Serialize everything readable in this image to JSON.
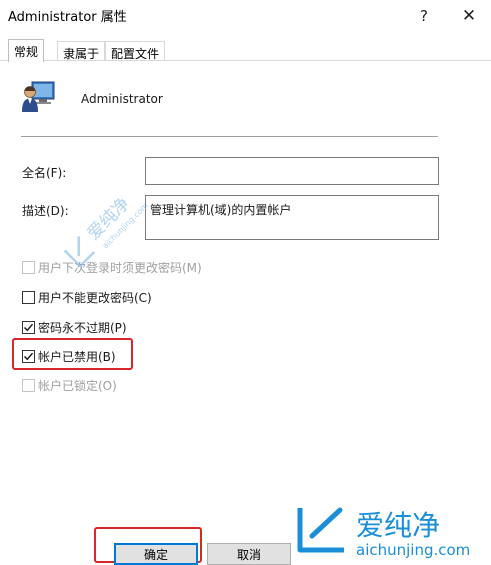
{
  "window": {
    "title": "Administrator 属性",
    "help_glyph": "?",
    "close_glyph": "✕"
  },
  "tabs": [
    {
      "label": "常规",
      "active": true
    },
    {
      "label": "隶属于",
      "active": false
    },
    {
      "label": "配置文件",
      "active": false
    }
  ],
  "user": {
    "name": "Administrator",
    "icon": "user-computer-icon"
  },
  "form": {
    "fullname_label": "全名(F):",
    "fullname_value": "",
    "description_label": "描述(D):",
    "description_value": "管理计算机(域)的内置帐户"
  },
  "checkboxes": [
    {
      "label": "用户下次登录时须更改密码(M)",
      "checked": false,
      "enabled": false
    },
    {
      "label": "用户不能更改密码(C)",
      "checked": false,
      "enabled": true
    },
    {
      "label": "密码永不过期(P)",
      "checked": true,
      "enabled": true
    },
    {
      "label": "帐户已禁用(B)",
      "checked": true,
      "enabled": true
    },
    {
      "label": "帐户已锁定(O)",
      "checked": false,
      "enabled": false
    }
  ],
  "buttons": {
    "ok": "确定",
    "cancel": "取消"
  },
  "watermark": {
    "brand_cn": "爱纯净",
    "brand_url": "aichunjing.com",
    "logo_color": "#1a8fd8"
  },
  "highlight_color": "#d9262b"
}
